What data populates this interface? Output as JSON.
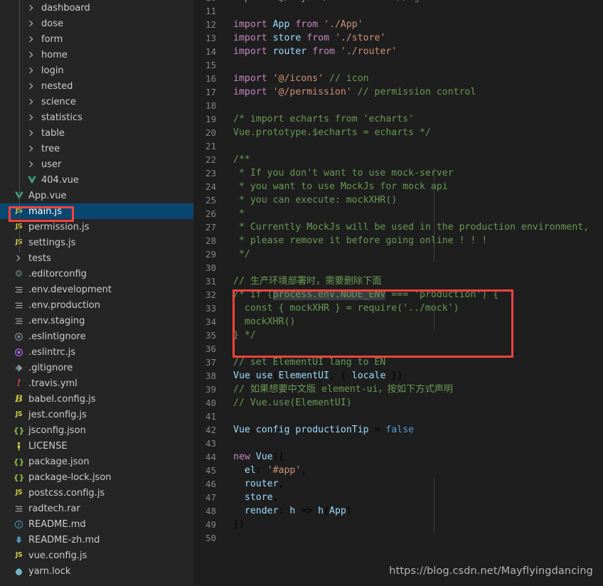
{
  "theme": {
    "sidebar_bg": "#252526",
    "editor_bg": "#1e1e1e",
    "selected_row_bg": "#094771",
    "annotation_color": "#f4433c",
    "line_number_color": "#858585",
    "comment_color": "#6a9955"
  },
  "sidebar": {
    "items": [
      {
        "label": "dashboard",
        "icon": "chevron-right-icon",
        "kind": "folder",
        "indent": 1,
        "selected": false
      },
      {
        "label": "dose",
        "icon": "chevron-right-icon",
        "kind": "folder",
        "indent": 1,
        "selected": false
      },
      {
        "label": "form",
        "icon": "chevron-right-icon",
        "kind": "folder",
        "indent": 1,
        "selected": false
      },
      {
        "label": "home",
        "icon": "chevron-right-icon",
        "kind": "folder",
        "indent": 1,
        "selected": false
      },
      {
        "label": "login",
        "icon": "chevron-right-icon",
        "kind": "folder",
        "indent": 1,
        "selected": false
      },
      {
        "label": "nested",
        "icon": "chevron-right-icon",
        "kind": "folder",
        "indent": 1,
        "selected": false
      },
      {
        "label": "science",
        "icon": "chevron-right-icon",
        "kind": "folder",
        "indent": 1,
        "selected": false
      },
      {
        "label": "statistics",
        "icon": "chevron-right-icon",
        "kind": "folder",
        "indent": 1,
        "selected": false
      },
      {
        "label": "table",
        "icon": "chevron-right-icon",
        "kind": "folder",
        "indent": 1,
        "selected": false
      },
      {
        "label": "tree",
        "icon": "chevron-right-icon",
        "kind": "folder",
        "indent": 1,
        "selected": false
      },
      {
        "label": "user",
        "icon": "chevron-right-icon",
        "kind": "folder",
        "indent": 1,
        "selected": false
      },
      {
        "label": "404.vue",
        "icon": "vue-file-icon",
        "kind": "file",
        "indent": 1,
        "selected": false
      },
      {
        "label": "App.vue",
        "icon": "vue-file-icon",
        "kind": "file",
        "indent": 0,
        "selected": false
      },
      {
        "label": "main.js",
        "icon": "js-file-icon",
        "kind": "file",
        "indent": 0,
        "selected": true
      },
      {
        "label": "permission.js",
        "icon": "js-file-icon",
        "kind": "file",
        "indent": 0,
        "selected": false
      },
      {
        "label": "settings.js",
        "icon": "js-file-icon",
        "kind": "file",
        "indent": 0,
        "selected": false
      },
      {
        "label": "tests",
        "icon": "chevron-right-icon",
        "kind": "folder",
        "indent": 0,
        "selected": false
      },
      {
        "label": ".editorconfig",
        "icon": "gear-icon",
        "kind": "file",
        "indent": 0,
        "selected": false
      },
      {
        "label": ".env.development",
        "icon": "settings-lines-icon",
        "kind": "file",
        "indent": 0,
        "selected": false
      },
      {
        "label": ".env.production",
        "icon": "settings-lines-icon",
        "kind": "file",
        "indent": 0,
        "selected": false
      },
      {
        "label": ".env.staging",
        "icon": "settings-lines-icon",
        "kind": "file",
        "indent": 0,
        "selected": false
      },
      {
        "label": ".eslintignore",
        "icon": "eslint-gray-icon",
        "kind": "file",
        "indent": 0,
        "selected": false
      },
      {
        "label": ".eslintrc.js",
        "icon": "eslint-purple-icon",
        "kind": "file",
        "indent": 0,
        "selected": false
      },
      {
        "label": ".gitignore",
        "icon": "git-icon",
        "kind": "file",
        "indent": 0,
        "selected": false
      },
      {
        "label": ".travis.yml",
        "icon": "travis-icon",
        "kind": "file",
        "indent": 0,
        "selected": false
      },
      {
        "label": "babel.config.js",
        "icon": "babel-icon",
        "kind": "file",
        "indent": 0,
        "selected": false
      },
      {
        "label": "jest.config.js",
        "icon": "js-file-icon",
        "kind": "file",
        "indent": 0,
        "selected": false
      },
      {
        "label": "jsconfig.json",
        "icon": "json-icon",
        "kind": "file",
        "indent": 0,
        "selected": false
      },
      {
        "label": "LICENSE",
        "icon": "license-icon",
        "kind": "file",
        "indent": 0,
        "selected": false
      },
      {
        "label": "package.json",
        "icon": "json-icon",
        "kind": "file",
        "indent": 0,
        "selected": false
      },
      {
        "label": "package-lock.json",
        "icon": "json-icon",
        "kind": "file",
        "indent": 0,
        "selected": false
      },
      {
        "label": "postcss.config.js",
        "icon": "js-file-icon",
        "kind": "file",
        "indent": 0,
        "selected": false
      },
      {
        "label": "radtech.rar",
        "icon": "settings-lines-icon",
        "kind": "file",
        "indent": 0,
        "selected": false
      },
      {
        "label": "README.md",
        "icon": "info-icon",
        "kind": "file",
        "indent": 0,
        "selected": false
      },
      {
        "label": "README-zh.md",
        "icon": "download-icon",
        "kind": "file",
        "indent": 0,
        "selected": false
      },
      {
        "label": "vue.config.js",
        "icon": "js-file-icon",
        "kind": "file",
        "indent": 0,
        "selected": false
      },
      {
        "label": "yarn.lock",
        "icon": "yarn-icon",
        "kind": "file",
        "indent": 0,
        "selected": false
      }
    ]
  },
  "editor": {
    "filename": "main.js",
    "first_visible_line": 10,
    "last_visible_line": 50,
    "lines": [
      {
        "n": 10,
        "text": "import '@/styles/index.scss' // global css"
      },
      {
        "n": 11,
        "text": ""
      },
      {
        "n": 12,
        "text": "import App from './App'"
      },
      {
        "n": 13,
        "text": "import store from './store'"
      },
      {
        "n": 14,
        "text": "import router from './router'"
      },
      {
        "n": 15,
        "text": ""
      },
      {
        "n": 16,
        "text": "import '@/icons' // icon"
      },
      {
        "n": 17,
        "text": "import '@/permission' // permission control"
      },
      {
        "n": 18,
        "text": ""
      },
      {
        "n": 19,
        "text": "/* import echarts from 'echarts'"
      },
      {
        "n": 20,
        "text": "Vue.prototype.$echarts = echarts */"
      },
      {
        "n": 21,
        "text": ""
      },
      {
        "n": 22,
        "text": "/**"
      },
      {
        "n": 23,
        "text": " * If you don't want to use mock-server"
      },
      {
        "n": 24,
        "text": " * you want to use MockJs for mock api"
      },
      {
        "n": 25,
        "text": " * you can execute: mockXHR()"
      },
      {
        "n": 26,
        "text": " *"
      },
      {
        "n": 27,
        "text": " * Currently MockJs will be used in the production environment,"
      },
      {
        "n": 28,
        "text": " * please remove it before going online ! ! !"
      },
      {
        "n": 29,
        "text": " */"
      },
      {
        "n": 30,
        "text": ""
      },
      {
        "n": 31,
        "text": "// 生产环境部署时，需要删除下面"
      },
      {
        "n": 32,
        "text": "/* if (process.env.NODE_ENV === 'production') {"
      },
      {
        "n": 33,
        "text": "  const { mockXHR } = require('../mock')"
      },
      {
        "n": 34,
        "text": "  mockXHR()"
      },
      {
        "n": 35,
        "text": "} */"
      },
      {
        "n": 36,
        "text": ""
      },
      {
        "n": 37,
        "text": "// set ElementUI lang to EN"
      },
      {
        "n": 38,
        "text": "Vue.use(ElementUI, { locale })"
      },
      {
        "n": 39,
        "text": "// 如果想要中文版 element-ui，按如下方式声明"
      },
      {
        "n": 40,
        "text": "// Vue.use(ElementUI)"
      },
      {
        "n": 41,
        "text": ""
      },
      {
        "n": 42,
        "text": "Vue.config.productionTip = false"
      },
      {
        "n": 43,
        "text": ""
      },
      {
        "n": 44,
        "text": "new Vue({"
      },
      {
        "n": 45,
        "text": "  el: '#app',"
      },
      {
        "n": 46,
        "text": "  router,"
      },
      {
        "n": 47,
        "text": "  store,"
      },
      {
        "n": 48,
        "text": "  render: h => h(App)"
      },
      {
        "n": 49,
        "text": "})"
      },
      {
        "n": 50,
        "text": ""
      }
    ],
    "selection_text": "process.env.NODE_ENV",
    "annotations": [
      {
        "name": "code-block-highlight",
        "target_lines": "32-35"
      },
      {
        "name": "sidebar-file-highlight",
        "target": "main.js"
      }
    ]
  },
  "watermark": {
    "text": "https://blog.csdn.net/Mayflyingdancing"
  }
}
